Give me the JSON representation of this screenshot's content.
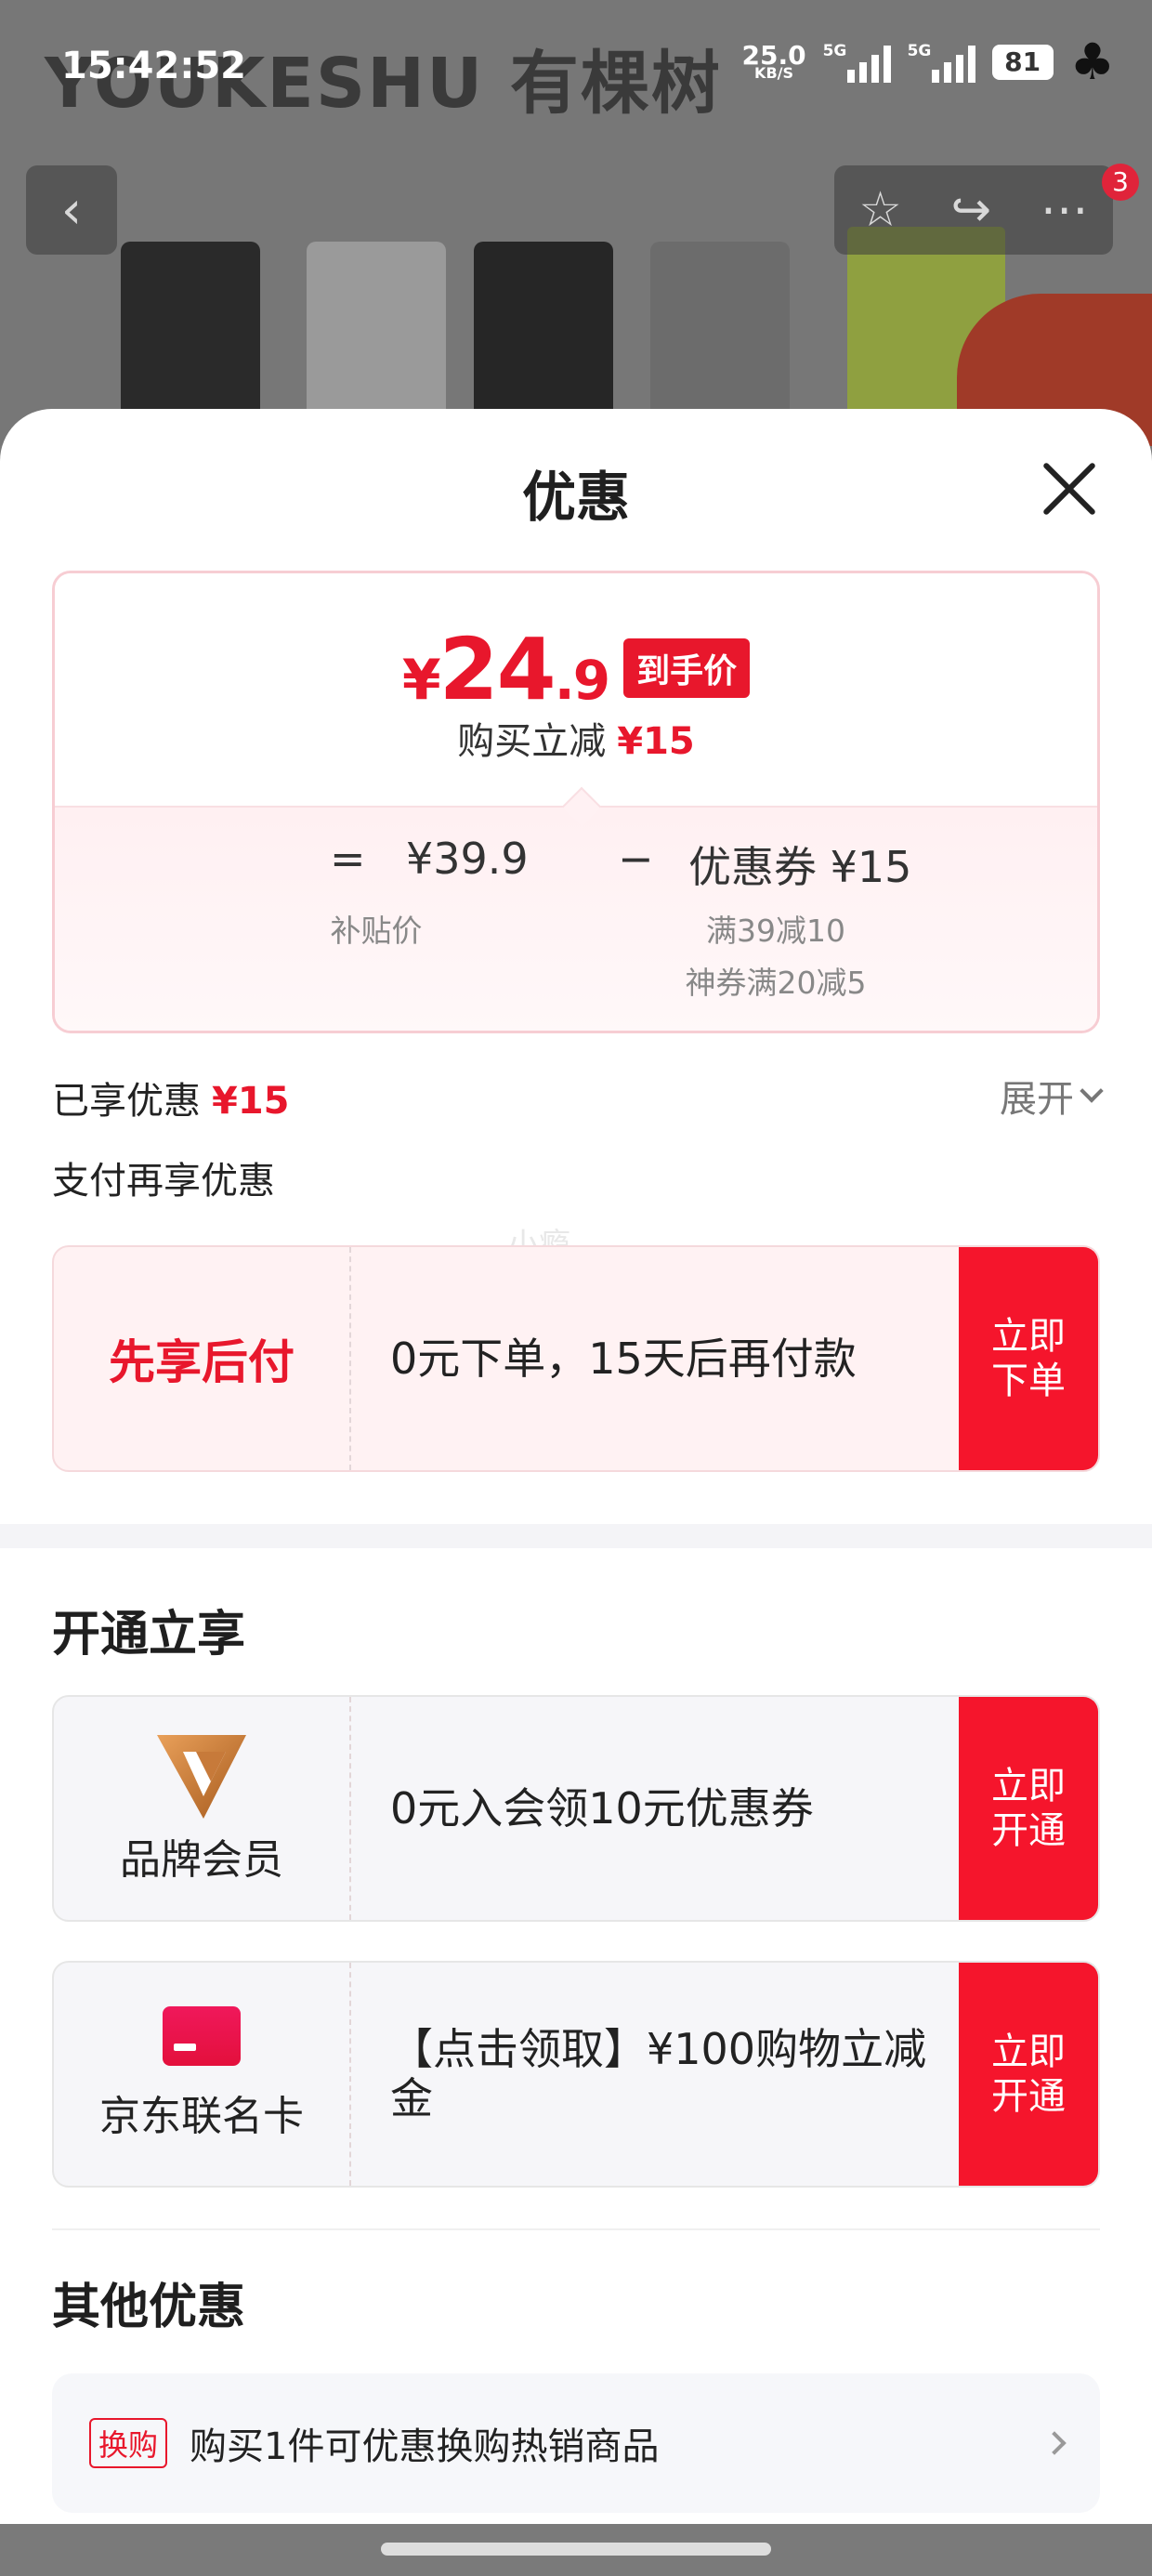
{
  "background": {
    "brand_text": "YOUKESHU 有棵树",
    "cart_count": "3"
  },
  "statusbar": {
    "time": "15:42:52",
    "net_speed": "25.0",
    "net_unit": "KB/S",
    "sig1_label": "5G",
    "sig2_label": "5G",
    "battery": "81"
  },
  "sheet": {
    "title": "优惠"
  },
  "price_card": {
    "currency": "¥",
    "price_int": "24",
    "price_dec": ".9",
    "price_tag": "到手价",
    "reduce_label": "购买立减",
    "reduce_value": "¥15",
    "eq": "=",
    "base_price": "¥39.9",
    "base_price_label": "补贴价",
    "minus": "−",
    "coupon": "优惠券 ¥15",
    "coupon_detail_1": "满39减10",
    "coupon_detail_2": "神券满20减5"
  },
  "discount_summary": {
    "label": "已享优惠",
    "value": "¥15",
    "expand": "展开"
  },
  "pay_section": {
    "title": "支付再享优惠",
    "watermark": "小瘾"
  },
  "pay_later": {
    "name": "先享后付",
    "desc": "0元下单，15天后再付款",
    "button": "立即下单"
  },
  "open_section": {
    "title": "开通立享",
    "items": [
      {
        "name": "品牌会员",
        "desc": "0元入会领10元优惠券",
        "button": "立即开通",
        "icon": "brand-vip-icon"
      },
      {
        "name": "京东联名卡",
        "desc": "【点击领取】¥100购物立减金",
        "button": "立即开通",
        "icon": "credit-card-icon"
      }
    ]
  },
  "other_section": {
    "title": "其他优惠",
    "items": [
      {
        "badge": "换购",
        "text": "购买1件可优惠换购热销商品"
      }
    ]
  },
  "colors": {
    "accent_red": "#e8172c",
    "button_red": "#f5152c"
  }
}
